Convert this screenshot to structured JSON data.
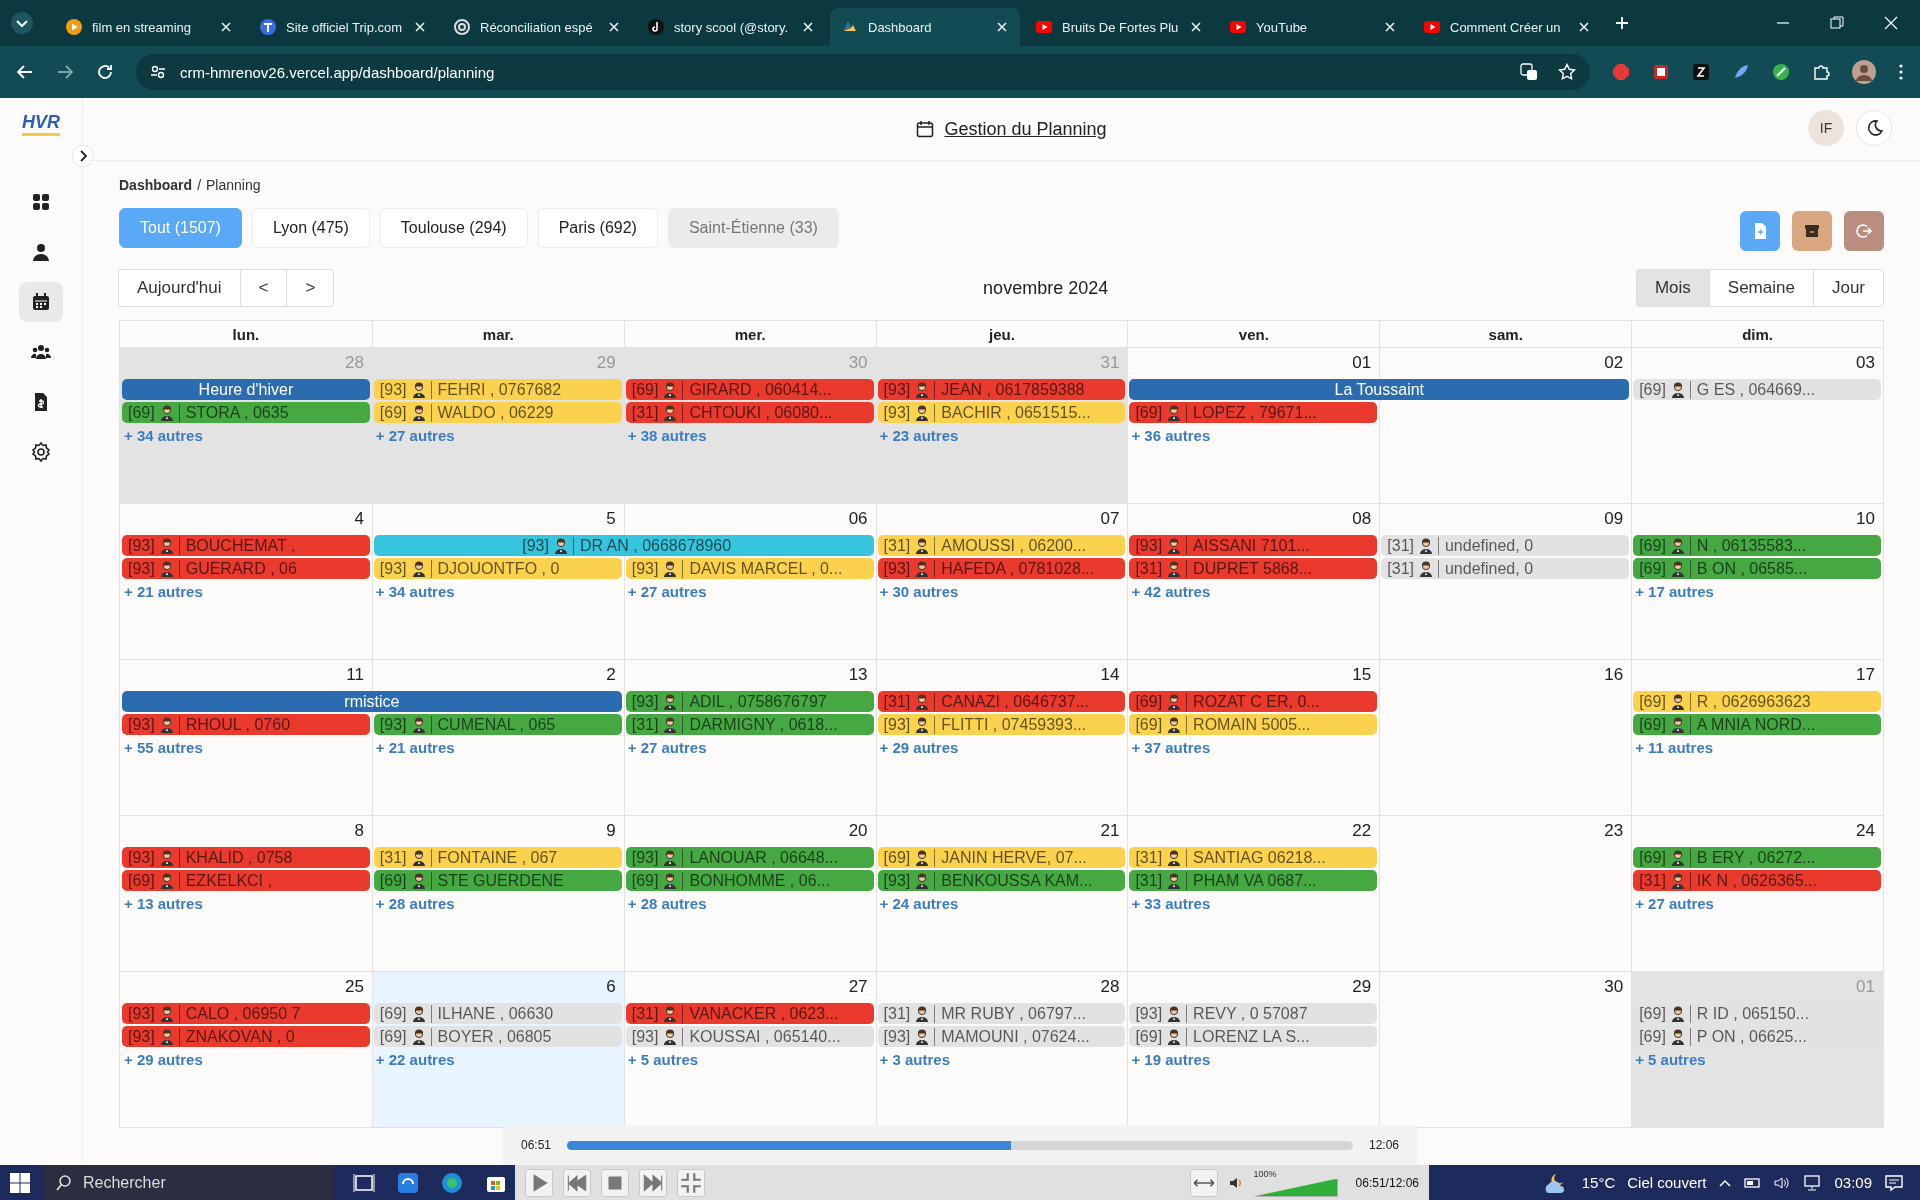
{
  "browser": {
    "tabs": [
      {
        "title": "film en streaming",
        "selected": false
      },
      {
        "title": "Site officiel Trip.com",
        "selected": false
      },
      {
        "title": "Réconciliation espé",
        "selected": false
      },
      {
        "title": "story scool (@story.",
        "selected": false
      },
      {
        "title": "Dashboard",
        "selected": true
      },
      {
        "title": "Bruits De Fortes Plu",
        "selected": false
      },
      {
        "title": "YouTube",
        "selected": false
      },
      {
        "title": "Comment Créer un",
        "selected": false
      }
    ],
    "url": "crm-hmrenov26.vercel.app/dashboard/planning"
  },
  "app": {
    "logo": "HVR",
    "title": "Gestion du Planning",
    "avatar": "IF",
    "sidebar": [
      {
        "selected": false
      },
      {
        "selected": false
      },
      {
        "selected": true
      },
      {
        "selected": false
      },
      {
        "selected": false
      },
      {
        "selected": false
      }
    ],
    "breadcrumb": {
      "parent": "Dashboard",
      "separator": "/",
      "current": "Planning"
    },
    "filters": [
      {
        "label": "Tout (1507)",
        "selected": true,
        "hovered": false
      },
      {
        "label": "Lyon (475)",
        "selected": false,
        "hovered": false
      },
      {
        "label": "Toulouse (294)",
        "selected": false,
        "hovered": false
      },
      {
        "label": "Paris (692)",
        "selected": false,
        "hovered": false
      },
      {
        "label": "Saint-Étienne (33)",
        "selected": false,
        "hovered": true
      }
    ],
    "actions": [
      {
        "color": "#5aa9f6"
      },
      {
        "color": "#d9a77f"
      },
      {
        "color": "#b98d7f"
      }
    ],
    "nav": {
      "today": "Aujourd'hui",
      "prev": "<",
      "next": ">"
    },
    "month_title": "novembre 2024",
    "views": [
      {
        "label": "Mois",
        "selected": true
      },
      {
        "label": "Semaine",
        "selected": false
      },
      {
        "label": "Jour",
        "selected": false
      }
    ],
    "weekdays": [
      "lun.",
      "mar.",
      "mer.",
      "jeu.",
      "ven.",
      "sam.",
      "dim."
    ],
    "weeks": [
      {
        "days": [
          {
            "num": "28",
            "muted": true,
            "today": false,
            "more": "+ 34 autres"
          },
          {
            "num": "29",
            "muted": true,
            "today": false,
            "more": "+ 27 autres"
          },
          {
            "num": "30",
            "muted": true,
            "today": false,
            "more": "+ 38 autres"
          },
          {
            "num": "31",
            "muted": true,
            "today": false,
            "more": "+ 23 autres"
          },
          {
            "num": "01",
            "muted": false,
            "today": false,
            "more": "+ 36 autres"
          },
          {
            "num": "02",
            "muted": false,
            "today": false
          },
          {
            "num": "03",
            "muted": false,
            "today": false
          }
        ],
        "lanes": [
          [
            {
              "kind": "holiday",
              "color": "#2b6cb0",
              "name": "Heure d'hiver",
              "wide": false
            },
            {
              "kind": "appointment",
              "color": "#fbd24e",
              "code": "[93]",
              "name": "FEHRI , 0767682",
              "wide": false
            },
            {
              "kind": "appointment",
              "color": "#ea3a2e",
              "code": "[69]",
              "name": "GIRARD , 060414...",
              "wide": false
            },
            {
              "kind": "appointment",
              "color": "#ea3a2e",
              "code": "[93]",
              "name": "JEAN , 0617859388",
              "wide": false
            },
            {
              "kind": "holiday",
              "color": "#2b6cb0",
              "name": "La Toussaint",
              "wide": true
            },
            {
              "kind": "appointment",
              "color": "#e2e2e2",
              "code": "[69]",
              "name": "G ES , 064669...",
              "wide": false
            }
          ],
          [
            {
              "kind": "appointment",
              "color": "#46a843",
              "code": "[69]",
              "name": "STORA , 0635",
              "wide": false
            },
            {
              "kind": "appointment",
              "color": "#fbd24e",
              "code": "[69]",
              "name": "WALDO , 06229",
              "wide": false
            },
            {
              "kind": "appointment",
              "color": "#ea3a2e",
              "code": "[31]",
              "name": "CHTOUKI , 06080...",
              "wide": false
            },
            {
              "kind": "appointment",
              "color": "#fbd24e",
              "code": "[93]",
              "name": "BACHIR , 0651515...",
              "wide": false
            },
            {
              "kind": "appointment",
              "color": "#ea3a2e",
              "code": "[69]",
              "name": "LOPEZ , 79671...",
              "wide": false
            },
            {
              "kind": "empty"
            },
            {
              "kind": "empty"
            }
          ]
        ]
      },
      {
        "days": [
          {
            "num": "4",
            "muted": false,
            "today": false,
            "more": "+ 21 autres"
          },
          {
            "num": "5",
            "muted": false,
            "today": false,
            "more": "+ 34 autres"
          },
          {
            "num": "06",
            "muted": false,
            "today": false,
            "more": "+ 27 autres"
          },
          {
            "num": "07",
            "muted": false,
            "today": false,
            "more": "+ 30 autres"
          },
          {
            "num": "08",
            "muted": false,
            "today": false,
            "more": "+ 42 autres"
          },
          {
            "num": "09",
            "muted": false,
            "today": false
          },
          {
            "num": "10",
            "muted": false,
            "today": false,
            "more": "+ 17 autres"
          }
        ],
        "lanes": [
          [
            {
              "kind": "appointment",
              "color": "#ea3a2e",
              "code": "[93]",
              "name": "BOUCHEMAT ,",
              "wide": false
            },
            {
              "kind": "appointment",
              "color": "#36c5dc",
              "code": "[93]",
              "name": "DR AN , 0668678960",
              "wide": true
            },
            {
              "kind": "appointment",
              "color": "#fbd24e",
              "code": "[31]",
              "name": "AMOUSSI , 06200...",
              "wide": false
            },
            {
              "kind": "appointment",
              "color": "#ea3a2e",
              "code": "[93]",
              "name": "AISSANI 7101...",
              "wide": false
            },
            {
              "kind": "appointment",
              "color": "#e2e2e2",
              "code": "[31]",
              "name": "undefined, 0",
              "wide": false
            },
            {
              "kind": "appointment",
              "color": "#46a843",
              "code": "[69]",
              "name": "N , 06135583...",
              "wide": false
            }
          ],
          [
            {
              "kind": "appointment",
              "color": "#ea3a2e",
              "code": "[93]",
              "name": "GUERARD , 06",
              "wide": false
            },
            {
              "kind": "appointment",
              "color": "#fbd24e",
              "code": "[93]",
              "name": "DJOUONTFO , 0",
              "wide": false
            },
            {
              "kind": "appointment",
              "color": "#fbd24e",
              "code": "[93]",
              "name": "DAVIS MARCEL , 0...",
              "wide": false
            },
            {
              "kind": "appointment",
              "color": "#ea3a2e",
              "code": "[93]",
              "name": "HAFEDA , 0781028...",
              "wide": false
            },
            {
              "kind": "appointment",
              "color": "#ea3a2e",
              "code": "[31]",
              "name": "DUPRET 5868...",
              "wide": false
            },
            {
              "kind": "appointment",
              "color": "#e2e2e2",
              "code": "[31]",
              "name": "undefined, 0",
              "wide": false
            },
            {
              "kind": "appointment",
              "color": "#46a843",
              "code": "[69]",
              "name": "B ON , 06585...",
              "wide": false
            }
          ]
        ]
      },
      {
        "days": [
          {
            "num": "11",
            "muted": false,
            "today": false,
            "more": "+ 55 autres"
          },
          {
            "num": "2",
            "muted": false,
            "today": false,
            "more": "+ 21 autres"
          },
          {
            "num": "13",
            "muted": false,
            "today": false,
            "more": "+ 27 autres"
          },
          {
            "num": "14",
            "muted": false,
            "today": false,
            "more": "+ 29 autres"
          },
          {
            "num": "15",
            "muted": false,
            "today": false,
            "more": "+ 37 autres"
          },
          {
            "num": "16",
            "muted": false,
            "today": false
          },
          {
            "num": "17",
            "muted": false,
            "today": false,
            "more": "+ 11 autres"
          }
        ],
        "lanes": [
          [
            {
              "kind": "holiday",
              "color": "#2b6cb0",
              "name": "rmistice",
              "wide": true
            },
            {
              "kind": "appointment",
              "color": "#46a843",
              "code": "[93]",
              "name": "ADIL , 0758676797",
              "wide": false
            },
            {
              "kind": "appointment",
              "color": "#ea3a2e",
              "code": "[31]",
              "name": "CANAZI , 0646737...",
              "wide": false
            },
            {
              "kind": "appointment",
              "color": "#ea3a2e",
              "code": "[69]",
              "name": "ROZAT C ER, 0...",
              "wide": false
            },
            {
              "kind": "empty"
            },
            {
              "kind": "appointment",
              "color": "#fbd24e",
              "code": "[69]",
              "name": "R , 0626963623",
              "wide": false
            }
          ],
          [
            {
              "kind": "appointment",
              "color": "#ea3a2e",
              "code": "[93]",
              "name": "RHOUL , 0760",
              "wide": false
            },
            {
              "kind": "appointment",
              "color": "#46a843",
              "code": "[93]",
              "name": "CUMENAL , 065",
              "wide": false
            },
            {
              "kind": "appointment",
              "color": "#46a843",
              "code": "[31]",
              "name": "DARMIGNY , 0618...",
              "wide": false
            },
            {
              "kind": "appointment",
              "color": "#fbd24e",
              "code": "[93]",
              "name": "FLITTI , 07459393...",
              "wide": false
            },
            {
              "kind": "appointment",
              "color": "#fbd24e",
              "code": "[69]",
              "name": "ROMAIN 5005...",
              "wide": false
            },
            {
              "kind": "empty"
            },
            {
              "kind": "appointment",
              "color": "#46a843",
              "code": "[69]",
              "name": "A MNIA NORD...",
              "wide": false
            }
          ]
        ]
      },
      {
        "days": [
          {
            "num": "8",
            "muted": false,
            "today": false,
            "more": "+ 13 autres"
          },
          {
            "num": "9",
            "muted": false,
            "today": false,
            "more": "+ 28 autres"
          },
          {
            "num": "20",
            "muted": false,
            "today": false,
            "more": "+ 28 autres"
          },
          {
            "num": "21",
            "muted": false,
            "today": false,
            "more": "+ 24 autres"
          },
          {
            "num": "22",
            "muted": false,
            "today": false,
            "more": "+ 33 autres"
          },
          {
            "num": "23",
            "muted": false,
            "today": false
          },
          {
            "num": "24",
            "muted": false,
            "today": false,
            "more": "+ 27 autres"
          }
        ],
        "lanes": [
          [
            {
              "kind": "appointment",
              "color": "#ea3a2e",
              "code": "[93]",
              "name": "KHALID , 0758",
              "wide": false
            },
            {
              "kind": "appointment",
              "color": "#fbd24e",
              "code": "[31]",
              "name": "FONTAINE , 067",
              "wide": false
            },
            {
              "kind": "appointment",
              "color": "#46a843",
              "code": "[93]",
              "name": "LANOUAR , 06648...",
              "wide": false
            },
            {
              "kind": "appointment",
              "color": "#fbd24e",
              "code": "[69]",
              "name": "JANIN HERVE, 07...",
              "wide": false
            },
            {
              "kind": "appointment",
              "color": "#fbd24e",
              "code": "[31]",
              "name": "SANTIAG 06218...",
              "wide": false
            },
            {
              "kind": "empty"
            },
            {
              "kind": "appointment",
              "color": "#46a843",
              "code": "[69]",
              "name": "B ERY , 06272...",
              "wide": false
            }
          ],
          [
            {
              "kind": "appointment",
              "color": "#ea3a2e",
              "code": "[69]",
              "name": "EZKELKCI ,",
              "wide": false
            },
            {
              "kind": "appointment",
              "color": "#46a843",
              "code": "[69]",
              "name": "STE GUERDENE",
              "wide": false
            },
            {
              "kind": "appointment",
              "color": "#46a843",
              "code": "[69]",
              "name": "BONHOMME , 06...",
              "wide": false
            },
            {
              "kind": "appointment",
              "color": "#46a843",
              "code": "[93]",
              "name": "BENKOUSSA KAM...",
              "wide": false
            },
            {
              "kind": "appointment",
              "color": "#46a843",
              "code": "[31]",
              "name": "PHAM VA 0687...",
              "wide": false
            },
            {
              "kind": "empty"
            },
            {
              "kind": "appointment",
              "color": "#ea3a2e",
              "code": "[31]",
              "name": "IK N , 0626365...",
              "wide": false
            }
          ]
        ]
      },
      {
        "days": [
          {
            "num": "25",
            "muted": false,
            "today": false,
            "more": "+ 29 autres"
          },
          {
            "num": "6",
            "muted": false,
            "today": true,
            "more": "+ 22 autres"
          },
          {
            "num": "27",
            "muted": false,
            "today": false,
            "more": "+ 5 autres"
          },
          {
            "num": "28",
            "muted": false,
            "today": false,
            "more": "+ 3 autres"
          },
          {
            "num": "29",
            "muted": false,
            "today": false,
            "more": "+ 19 autres"
          },
          {
            "num": "30",
            "muted": false,
            "today": false
          },
          {
            "num": "01",
            "muted": true,
            "today": false,
            "more": "+ 5 autres"
          }
        ],
        "lanes": [
          [
            {
              "kind": "appointment",
              "color": "#ea3a2e",
              "code": "[93]",
              "name": "CALO , 06950 7",
              "wide": false
            },
            {
              "kind": "appointment",
              "color": "#e2e2e2",
              "code": "[69]",
              "name": "ILHANE , 06630",
              "wide": false
            },
            {
              "kind": "appointment",
              "color": "#ea3a2e",
              "code": "[31]",
              "name": "VANACKER , 0623...",
              "wide": false
            },
            {
              "kind": "appointment",
              "color": "#e2e2e2",
              "code": "[31]",
              "name": "MR RUBY , 06797...",
              "wide": false
            },
            {
              "kind": "appointment",
              "color": "#e2e2e2",
              "code": "[93]",
              "name": "REVY , 0 57087",
              "wide": false
            },
            {
              "kind": "empty"
            },
            {
              "kind": "appointment",
              "color": "#e2e2e2",
              "code": "[69]",
              "name": "R ID , 065150...",
              "wide": false
            }
          ],
          [
            {
              "kind": "appointment",
              "color": "#ea3a2e",
              "code": "[93]",
              "name": "ZNAKOVAN , 0",
              "wide": false
            },
            {
              "kind": "appointment",
              "color": "#e2e2e2",
              "code": "[69]",
              "name": "BOYER , 06805",
              "wide": false
            },
            {
              "kind": "appointment",
              "color": "#e2e2e2",
              "code": "[93]",
              "name": "KOUSSAI , 065140...",
              "wide": false
            },
            {
              "kind": "appointment",
              "color": "#e2e2e2",
              "code": "[93]",
              "name": "MAMOUNI , 07624...",
              "wide": false
            },
            {
              "kind": "appointment",
              "color": "#e2e2e2",
              "code": "[69]",
              "name": "LORENZ LA S...",
              "wide": false
            },
            {
              "kind": "empty"
            },
            {
              "kind": "appointment",
              "color": "#e2e2e2",
              "code": "[69]",
              "name": "P ON , 06625...",
              "wide": false
            }
          ]
        ]
      }
    ]
  },
  "player": {
    "elapsed": "06:51",
    "duration": "12:06",
    "level": 0.565,
    "volume_label": "100%",
    "volume": {
      "level": 1.0
    },
    "clock": "06:51/12:06"
  },
  "taskbar": {
    "search": "Rechercher",
    "temperature": "15°C",
    "weather": "Ciel couvert",
    "time": "03:09"
  }
}
